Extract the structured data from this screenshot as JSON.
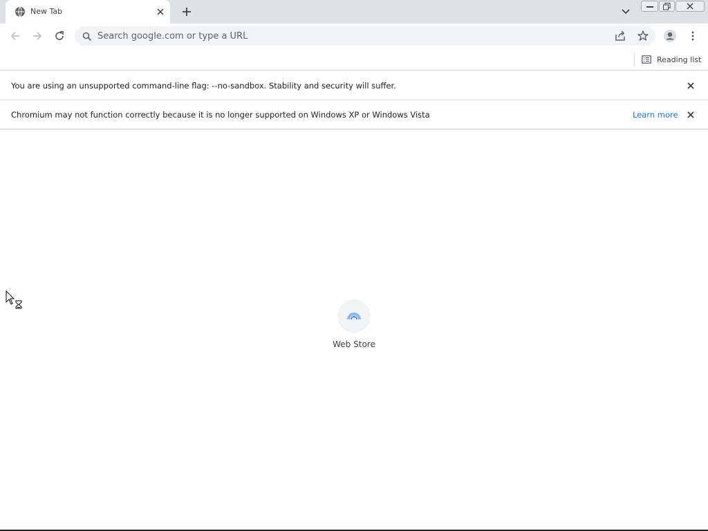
{
  "tab": {
    "title": "New Tab",
    "favicon": "globe-icon"
  },
  "toolbar": {
    "omnibox_placeholder": "Search google.com or type a URL"
  },
  "bookmark_bar": {
    "reading_list_label": "Reading list"
  },
  "infobars": [
    {
      "text": "You are using an unsupported command-line flag: --no-sandbox. Stability and security will suffer."
    },
    {
      "text": "Chromium may not function correctly because it is no longer supported on Windows XP or Windows Vista",
      "link_label": "Learn more"
    }
  ],
  "shortcuts": [
    {
      "label": "Web Store",
      "icon": "web-store-icon"
    }
  ],
  "colors": {
    "tabstrip_bg": "#dee1e6",
    "omnibox_bg": "#f1f3f4",
    "link": "#1a73e8"
  }
}
